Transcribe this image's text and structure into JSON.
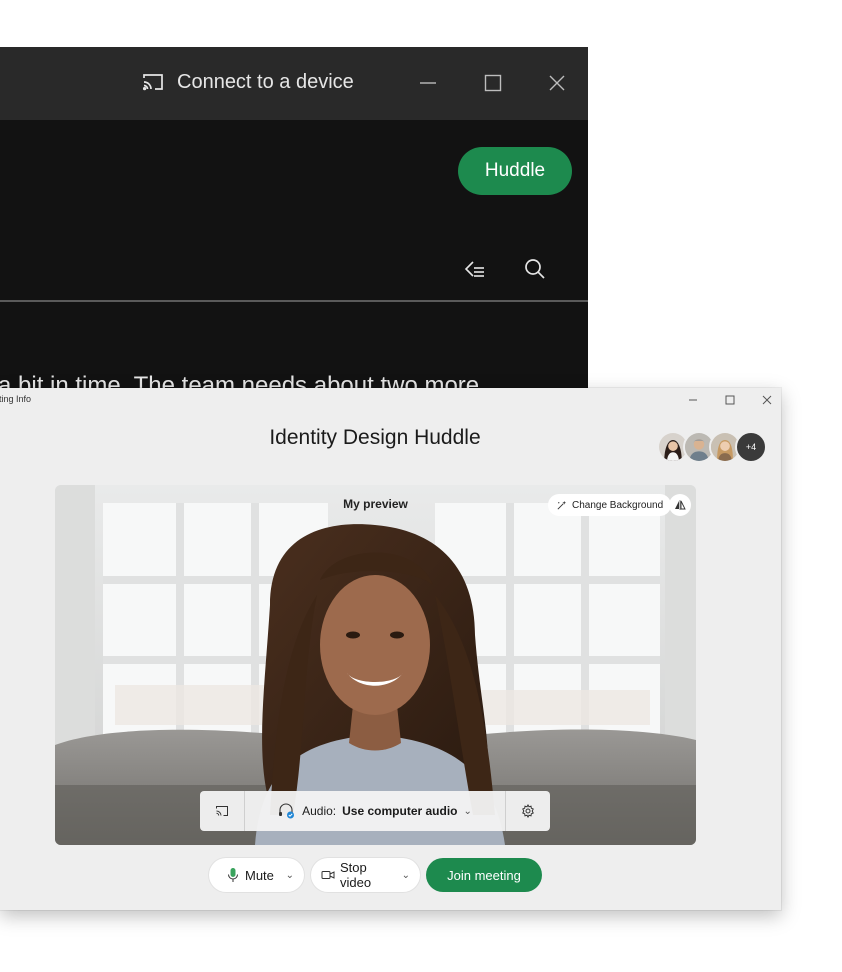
{
  "dark_window": {
    "titlebar": {
      "connect_label": "Connect to a device",
      "minimize_icon": "minimize-icon",
      "maximize_icon": "maximize-icon",
      "close_icon": "close-icon"
    },
    "huddle_button": "Huddle",
    "snippet_text": "a bit in time. The team needs about two more"
  },
  "meeting_window": {
    "tag_label": "eting Info",
    "title": "Identity Design Huddle",
    "participants_more": "+4",
    "preview": {
      "label": "My preview",
      "change_background": "Change Background"
    },
    "audio_bar": {
      "audio_prefix": "Audio:",
      "audio_value": "Use computer audio",
      "caret": "⌄"
    },
    "controls": {
      "mute_label": "Mute",
      "mute_caret": "⌄",
      "stop_video_label": "Stop video",
      "video_caret": "⌄",
      "join_label": "Join meeting"
    }
  },
  "colors": {
    "accent_green": "#1d8a4e",
    "dark_bg": "#121212",
    "dark_titlebar": "#292929",
    "window_bg": "#eeeeee"
  }
}
